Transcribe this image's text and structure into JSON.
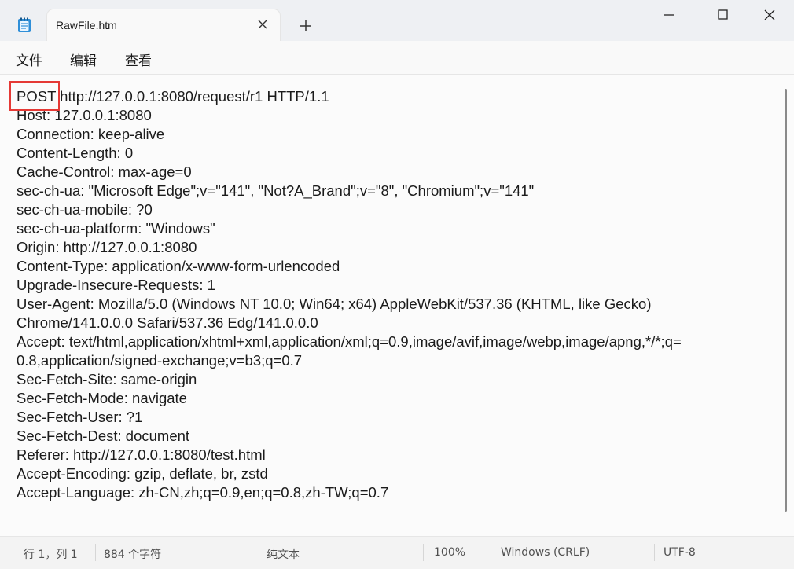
{
  "tab": {
    "title": "RawFile.htm"
  },
  "menu": {
    "file": "文件",
    "edit": "编辑",
    "view": "查看"
  },
  "document": {
    "lines": [
      "POST http://127.0.0.1:8080/request/r1 HTTP/1.1",
      "Host: 127.0.0.1:8080",
      "Connection: keep-alive",
      "Content-Length: 0",
      "Cache-Control: max-age=0",
      "sec-ch-ua: \"Microsoft Edge\";v=\"141\", \"Not?A_Brand\";v=\"8\", \"Chromium\";v=\"141\"",
      "sec-ch-ua-mobile: ?0",
      "sec-ch-ua-platform: \"Windows\"",
      "Origin: http://127.0.0.1:8080",
      "Content-Type: application/x-www-form-urlencoded",
      "Upgrade-Insecure-Requests: 1",
      "User-Agent: Mozilla/5.0 (Windows NT 10.0; Win64; x64) AppleWebKit/537.36 (KHTML, like Gecko)",
      "Chrome/141.0.0.0 Safari/537.36 Edg/141.0.0.0",
      "Accept: text/html,application/xhtml+xml,application/xml;q=0.9,image/avif,image/webp,image/apng,*/*;q=",
      "0.8,application/signed-exchange;v=b3;q=0.7",
      "Sec-Fetch-Site: same-origin",
      "Sec-Fetch-Mode: navigate",
      "Sec-Fetch-User: ?1",
      "Sec-Fetch-Dest: document",
      "Referer: http://127.0.0.1:8080/test.html",
      "Accept-Encoding: gzip, deflate, br, zstd",
      "Accept-Language: zh-CN,zh;q=0.9,en;q=0.8,zh-TW;q=0.7"
    ]
  },
  "status": {
    "cursor": "行 1，列 1",
    "chars": "884 个字符",
    "format": "纯文本",
    "zoom": "100%",
    "line_ending": "Windows (CRLF)",
    "encoding": "UTF-8"
  },
  "icons": {
    "app": "notepad-icon",
    "close_tab": "close-icon",
    "new_tab": "plus-icon",
    "copilot": "copilot-icon",
    "account": "account-icon",
    "settings": "gear-icon"
  },
  "colors": {
    "highlight": "#e53935"
  }
}
